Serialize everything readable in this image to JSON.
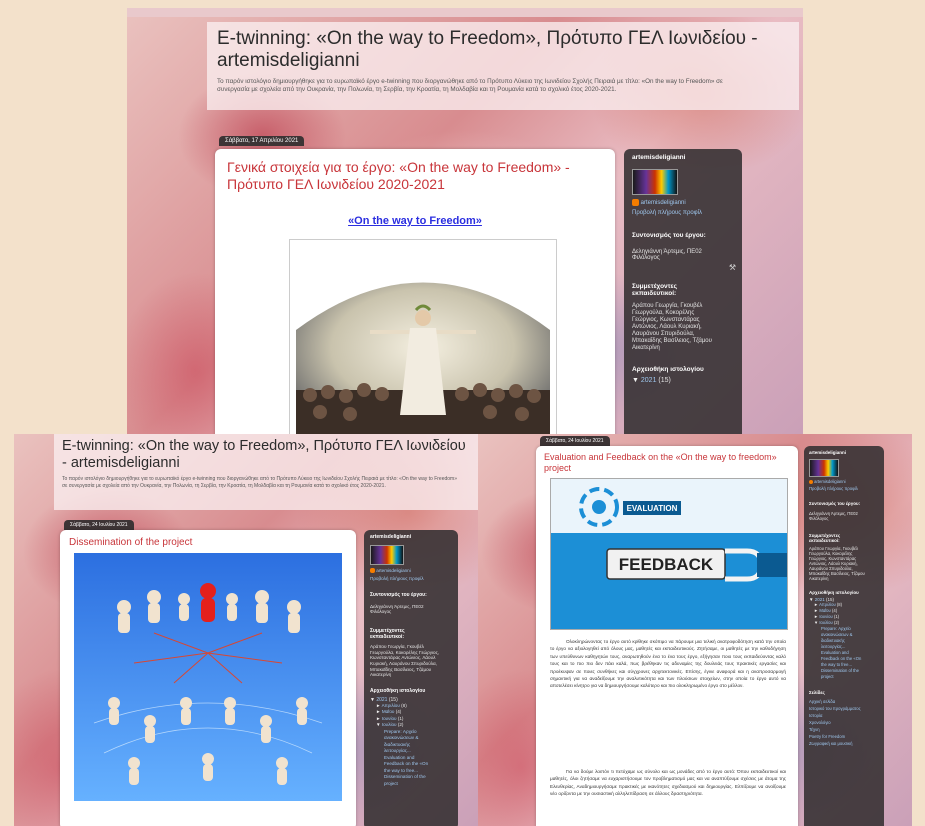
{
  "blog": {
    "title": "E-twinning: «On the way to Freedom», Πρότυπο ΓΕΛ Ιωνιδείου - artemisdeligianni",
    "description": "Το παρόν ιστολόγιο δημιουργήθηκε για το ευρωπαϊκό έργο e-twinning που διοργανώθηκε από το Πρότυπο Λύκειο της Ιωνιδείου Σχολής Πειραιά με τίτλο: «On the way to Freedom» σε συνεργασία με σχολεία από την Ουκρανία, την Πολωνία, τη Σερβία, την Κροατία, τη Μολδαβία και τη Ρουμανία κατά το σχολικό έτος 2020-2021."
  },
  "shot1": {
    "date": "Σάββατο, 17 Απριλίου 2021",
    "post_title": "Γενικά στοιχεία για το έργο: «On the way to Freedom» - Πρότυπο ΓΕΛ Ιωνιδείου 2020-2021",
    "project_link": "«On the way to Freedom»"
  },
  "shot2": {
    "date": "Σάββατο, 24 Ιουλίου 2021",
    "post_title": "Dissemination of the project"
  },
  "shot3": {
    "date": "Σάββατο, 24 Ιουλίου 2021",
    "post_title": "Evaluation and Feedback on the «On the way to freedom» project",
    "image_label_1": "EVALUATION",
    "image_label_2": "FEEDBACK",
    "para1": "Ολοκληρώνοντας το έργο αυτό κρίθηκε σκόπιμο να πάρουμε μια τελική ανατροφοδότηση κατά την οποία το έργο να αξιολογηθεί από όλους μας, μαθητές και εκπαιδευτικούς. Ζητήσαμε, οι μαθητές με την καθοδήγηση των υπεύθυνων καθηγητών τους, αναρωτηθούν ένα το ένα τους έργο, εξήγησαν ποιο τους εκπαιδεύοντας καλό τους και το πιο πιο δεν πάει καλά, πως βρέθηκαν τις αδυναμίες της δουλειάς τους πρακτικές εργασίες και προέκυψαν σε ποιες συνθήκες και σύγχρονες αρχιτεκτονικές. Επίσης, έγινε αναφορά και η αναπροσαρμογή σημαντική για να αναδείξουμε την αναλυτικότητα και των πλούσιων στοιχείων, στην οποία το έργο αυτό να αποτελέσει κίνητρο για να δημιουργήσουμε καλύτερο και πιο ολοκληρωμένο έργο στο μέλλον.",
    "para2": "Για να δούμε λοιπόν τι πετύχαμε ως σύνολο και ως μονάδες από το έργο αυτό: Όπου εκπαιδευτικοί και μαθητές, όλοι ζητήσαμε να ευχαριστήσουμε τον προβληματισμό μας και να αναπτύξουμε σχέσεις με άτομα της Ελευθερίας, Αναδημιουργήσαμε πρακτικές με ικανότητες σχεδιασμού και δημιουργίας. Ελπίζουμε να ανοίξουμε νέο ορίζοντα με την ουσιαστική αλληλεπίδραση σε άλλους δραστηριότητα."
  },
  "sidebar": {
    "username": "artemisdeligianni",
    "profile_link": "Προβολή πλήρους προφίλ",
    "coordinator_heading": "Συντονισμός του έργου:",
    "coordinator_name": "Δεληγιάννη Άρτεμις, ΠΕ02 Φιλόλογος",
    "teachers_heading": "Συμμετέχοντες εκπαιδευτικοί:",
    "teachers": "Αράπου Γεωργία, Γκουβέλ Γεωργούλα, Κοκορέλης Γεώργιος, Κωνσταντάρας Αντώνιος, Λάουλ Κυριακή, Λαυράνου Σπυριδούλα, Μπακαΐδης Βασίλειος, Τζάμου Αικατερίνη",
    "archive_heading": "Αρχειοθήκη ιστολογίου",
    "archive_year": "2021",
    "archive_year_count": "(15)",
    "archive_months": [
      {
        "label": "Απριλίου",
        "count": "(8)"
      },
      {
        "label": "Μαΐου",
        "count": "(4)"
      },
      {
        "label": "Ιουνίου",
        "count": "(1)"
      },
      {
        "label": "Ιουλίου",
        "count": "(2)"
      }
    ],
    "archive_posts": [
      "Prepare: Αρχείο ανακοινώσεων & διαδικτυακής λειτουργίας...",
      "Evaluation and Feedback on the «On the way to free...",
      "Dissemination of the project"
    ],
    "pages_heading": "Σελίδες",
    "pages": [
      "Αρχική σελίδα",
      "Ιστορικό του προγράμματος",
      "Ιστορία",
      "Χρονολόγιο",
      "Τέχνη",
      "Poetry for Freedom",
      "Ζωγραφική και μουσική"
    ]
  }
}
